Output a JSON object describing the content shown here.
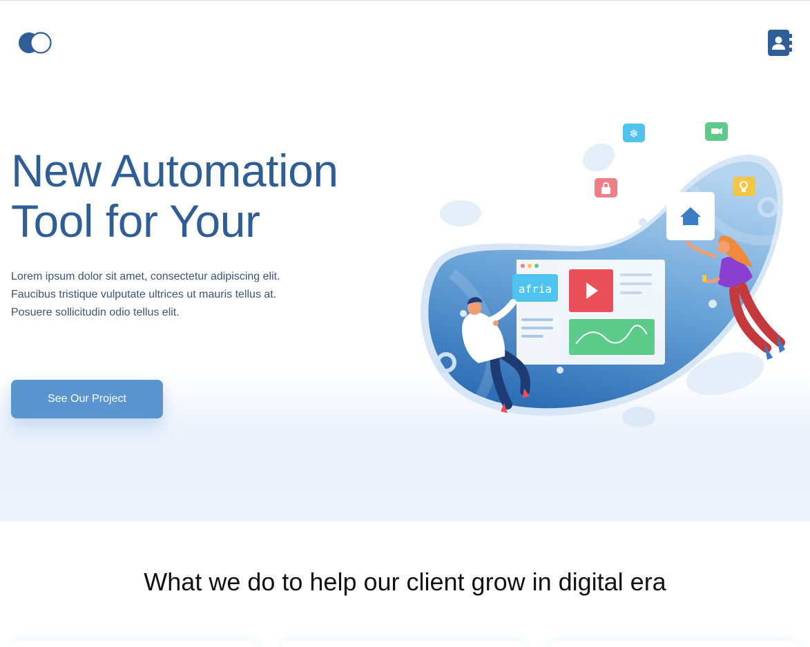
{
  "hero": {
    "title_line1": "New Automation",
    "title_line2": "Tool for Your",
    "desc_line1": "Lorem ipsum dolor sit amet, consectetur adipiscing elit.",
    "desc_line2": "Faucibus tristique vulputate ultrices ut mauris tellus at.",
    "desc_line3": "Posuere sollicitudin odio tellus elit.",
    "cta_label": "See Our Project"
  },
  "illustration": {
    "screen_badge": "afria"
  },
  "services": {
    "title": "What we do to help our client grow in digital era"
  },
  "colors": {
    "brand": "#2f5e96",
    "accent": "#5b95cf",
    "text": "#3b5477"
  },
  "icons": {
    "logo": "toggle-circles-logo",
    "contacts": "address-book-icon"
  }
}
